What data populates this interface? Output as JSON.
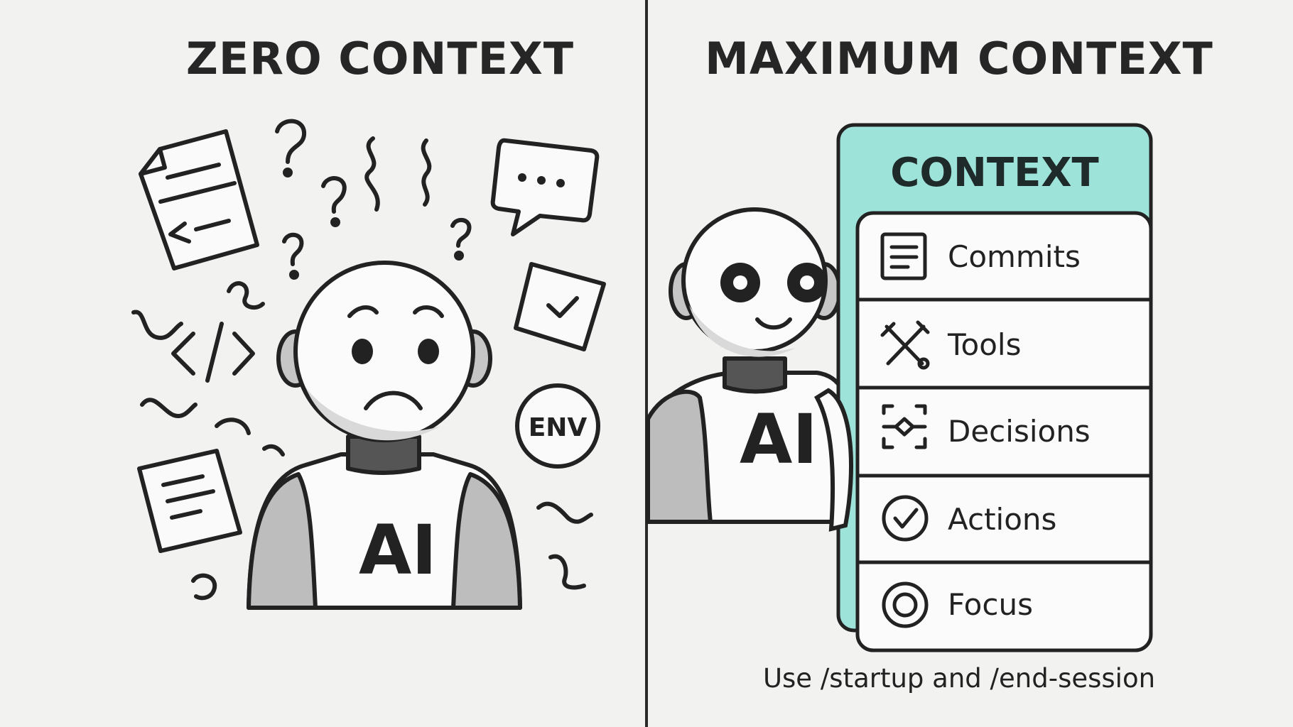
{
  "left_panel": {
    "title": "ZERO CONTEXT",
    "robot_label": "AI",
    "env_badge": "ENV",
    "code_glyph": "</>"
  },
  "right_panel": {
    "title": "MAXIMUM CONTEXT",
    "robot_label": "AI",
    "context_card": {
      "header": "CONTEXT",
      "items": [
        {
          "label": "Commits",
          "icon": "document-lines-icon"
        },
        {
          "label": "Tools",
          "icon": "wrench-screwdriver-icon"
        },
        {
          "label": "Decisions",
          "icon": "decision-diamond-icon"
        },
        {
          "label": "Actions",
          "icon": "check-circle-icon"
        },
        {
          "label": "Focus",
          "icon": "target-icon"
        }
      ]
    },
    "caption": "Use /startup and /end-session"
  },
  "colors": {
    "background": "#f2f2f1",
    "ink": "#222222",
    "accent_teal": "#9ee3da",
    "robot_gray": "#bdbdbd",
    "robot_dark": "#555555"
  }
}
